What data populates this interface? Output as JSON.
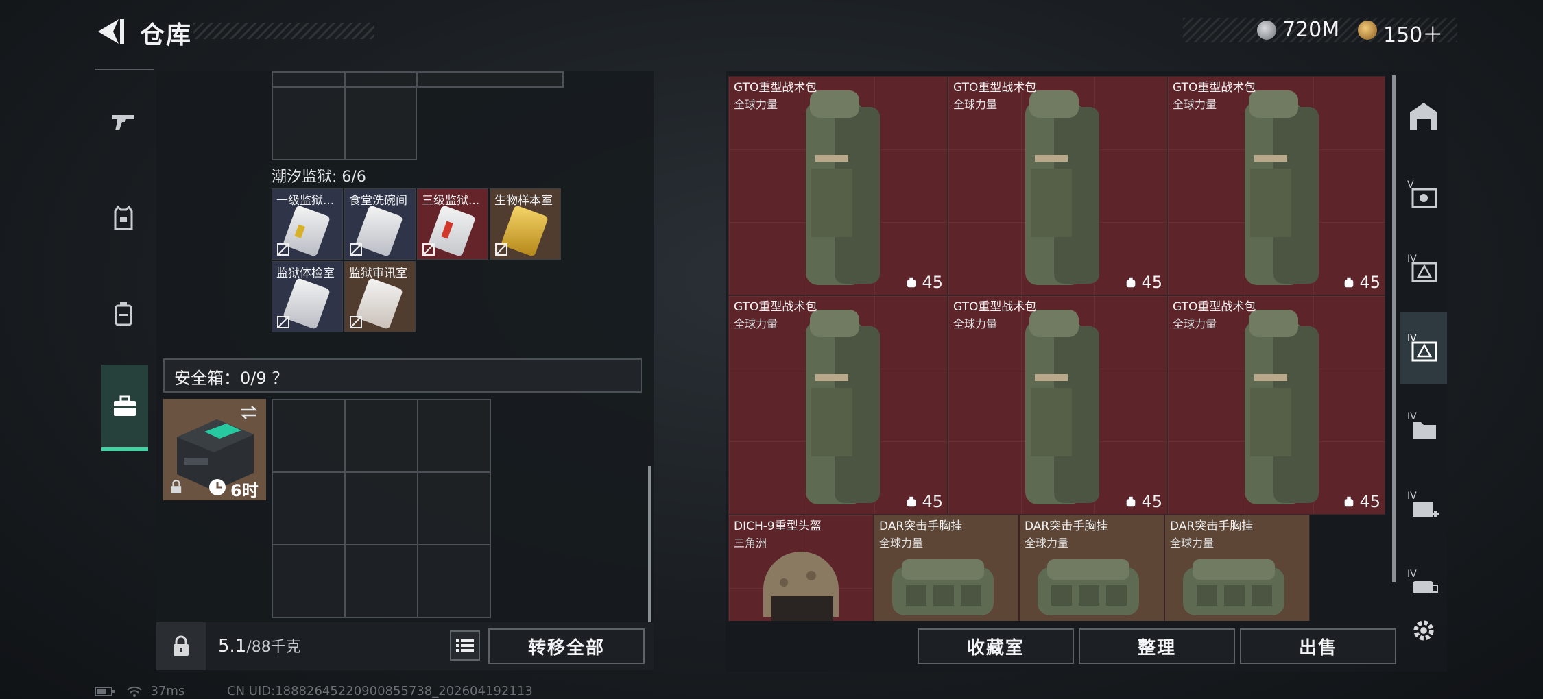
{
  "header": {
    "title": "仓库",
    "currencies": [
      {
        "icon": "silver-coin-icon",
        "value": "720M"
      },
      {
        "icon": "gold-triangle-coin-icon",
        "value": "150＋"
      }
    ]
  },
  "side_tabs": [
    {
      "icon": "pistol-icon"
    },
    {
      "icon": "armor-vest-icon"
    },
    {
      "icon": "backpack-icon"
    },
    {
      "icon": "toolbox-icon",
      "active": true
    }
  ],
  "container": {
    "section_title": "潮汐监狱: 6/6",
    "keys": [
      {
        "label": "一级监狱...",
        "color": "blue"
      },
      {
        "label": "食堂洗碗间",
        "color": "blue"
      },
      {
        "label": "三级监狱...",
        "color": "red"
      },
      {
        "label": "生物样本室",
        "color": "brown"
      },
      {
        "label": "监狱体检室",
        "color": "blue"
      },
      {
        "label": "监狱审讯室",
        "color": "brown"
      }
    ]
  },
  "safe_box": {
    "label": "安全箱：0/9 ？",
    "timer": "6时"
  },
  "weight": {
    "value": "5.1",
    "capacity": "/88千克"
  },
  "buttons": {
    "transfer_all": "转移全部",
    "collection": "收藏室",
    "organize": "整理",
    "sell": "出售"
  },
  "stash": {
    "items": [
      {
        "name": "GTO重型战术包",
        "sub": "全球力量",
        "count": "45"
      },
      {
        "name": "GTO重型战术包",
        "sub": "全球力量",
        "count": "45"
      },
      {
        "name": "GTO重型战术包",
        "sub": "全球力量",
        "count": "45"
      },
      {
        "name": "GTO重型战术包",
        "sub": "全球力量",
        "count": "45"
      },
      {
        "name": "GTO重型战术包",
        "sub": "全球力量",
        "count": "45"
      },
      {
        "name": "GTO重型战术包",
        "sub": "全球力量",
        "count": "45"
      },
      {
        "name": "DICH-9重型头盔",
        "sub": "三角洲"
      },
      {
        "name": "DAR突击手胸挂",
        "sub": "全球力量"
      },
      {
        "name": "DAR突击手胸挂",
        "sub": "全球力量"
      },
      {
        "name": "DAR突击手胸挂",
        "sub": "全球力量"
      }
    ]
  },
  "right_tabs": [
    {
      "icon": "storage-room-icon"
    },
    {
      "icon": "v-tier-filter-icon"
    },
    {
      "icon": "iv-tier-warning-icon"
    },
    {
      "icon": "iv-tier-warning-active-icon",
      "active": true
    },
    {
      "icon": "iv-tier-folder-icon"
    },
    {
      "icon": "iv-tier-medical-icon"
    },
    {
      "icon": "iv-tier-ammo-icon"
    },
    {
      "icon": "settings-gear-icon"
    }
  ],
  "status_bar": {
    "ping": "37ms",
    "uid": "CN UID:18882645220900855738_202604192113"
  }
}
